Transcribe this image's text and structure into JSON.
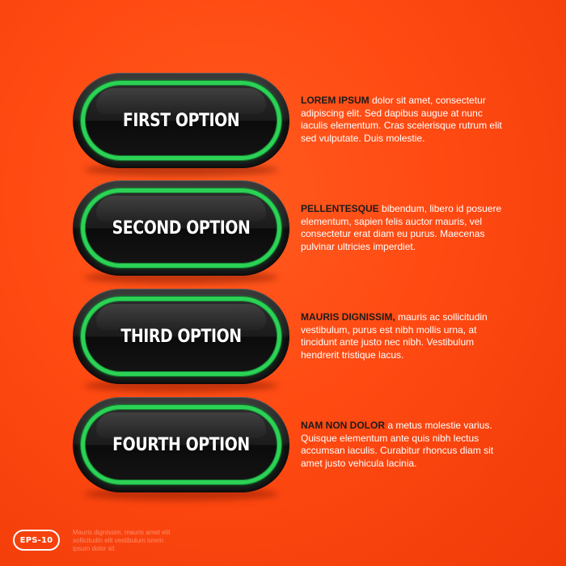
{
  "options": [
    {
      "label": "FIRST OPTION",
      "lead": "LOREM IPSUM",
      "body": " dolor sit amet, consectetur adipiscing elit. Sed dapibus augue at nunc iaculis elementum. Cras scelerisque rutrum elit sed vulputate. Duis molestie."
    },
    {
      "label": "SECOND OPTION",
      "lead": "PELLENTESQUE",
      "body": " bibendum, libero id posuere elementum, sapien felis auctor mauris, vel consectetur erat diam eu purus. Maecenas pulvinar ultricies imperdiet."
    },
    {
      "label": "THIRD OPTION",
      "lead": "MAURIS DIGNISSIM,",
      "body": " mauris ac sollicitudin vestibulum, purus est nibh mollis urna, at tincidunt ante justo nec nibh. Vestibulum hendrerit tristique lacus."
    },
    {
      "label": "FOURTH OPTION",
      "lead": "NAM NON DOLOR",
      "body": " a metus molestie varius. Quisque elementum ante quis nibh lectus accumsan iaculis. Curabitur rhoncus diam sit amet justo vehicula lacinia."
    }
  ],
  "footer": {
    "badge": "EPS-10",
    "note": "Mauris dignissim, mauris amet elit sollicitudin elit vestibulum lorem ipsum dolor sit"
  },
  "colors": {
    "background": "#ff4a12",
    "ring": "#2bd255",
    "pill": "#1b1b1b",
    "lead_text": "#1c1c1c",
    "body_text": "#ffffff"
  }
}
